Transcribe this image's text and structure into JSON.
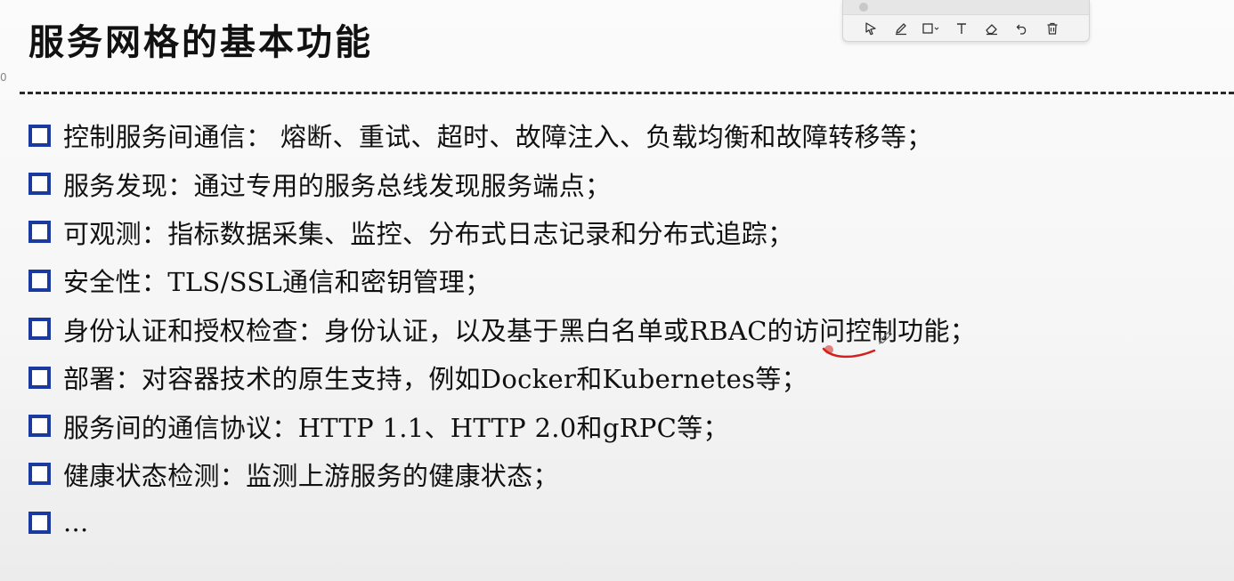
{
  "slide": {
    "title": "服务网格的基本功能",
    "edge_glyph": "0",
    "bullets": [
      "控制服务间通信： 熔断、重试、超时、故障注入、负载均衡和故障转移等；",
      "服务发现：通过专用的服务总线发现服务端点；",
      "可观测：指标数据采集、监控、分布式日志记录和分布式追踪；",
      "安全性：TLS/SSL通信和密钥管理；",
      "身份认证和授权检查：身份认证，以及基于黑白名单或RBAC的访问控制功能；",
      "部署：对容器技术的原生支持，例如Docker和Kubernetes等；",
      "服务间的通信协议：HTTP 1.1、HTTP 2.0和gRPC等；",
      "健康状态检测：监测上游服务的健康状态；",
      "..."
    ]
  },
  "annotation_toolbar": {
    "tools": [
      "select-icon",
      "pen-icon",
      "shape-icon",
      "text-icon",
      "eraser-icon",
      "undo-icon",
      "trash-icon"
    ]
  },
  "colors": {
    "bullet": "#1a3aa0",
    "annotation_stroke": "#d41f1f"
  }
}
